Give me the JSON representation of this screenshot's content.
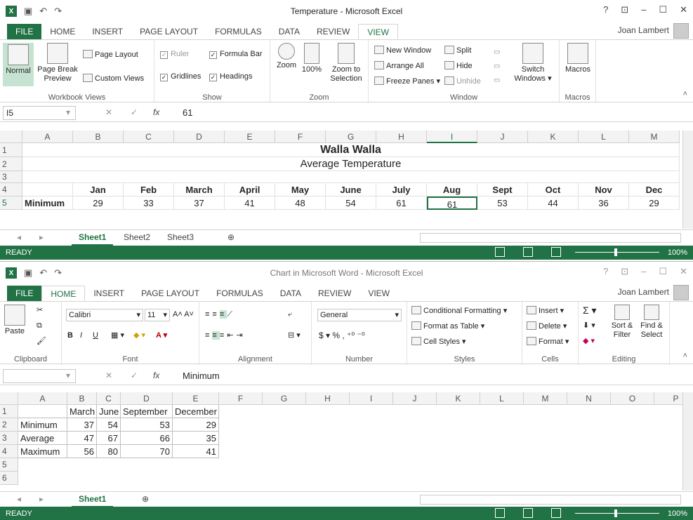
{
  "user": "Joan Lambert",
  "win1": {
    "title": "Temperature - Microsoft Excel",
    "tabs": [
      "FILE",
      "HOME",
      "INSERT",
      "PAGE LAYOUT",
      "FORMULAS",
      "DATA",
      "REVIEW",
      "VIEW"
    ],
    "active_tab": "VIEW",
    "groups": {
      "workbook": {
        "label": "Workbook Views",
        "normal": "Normal",
        "page_break": "Page Break Preview",
        "page_layout": "Page Layout",
        "custom_views": "Custom Views"
      },
      "show": {
        "label": "Show",
        "ruler": "Ruler",
        "formula_bar": "Formula Bar",
        "gridlines": "Gridlines",
        "headings": "Headings"
      },
      "zoom": {
        "label": "Zoom",
        "zoom": "Zoom",
        "z100": "100%",
        "zoom_sel": "Zoom to Selection"
      },
      "window": {
        "label": "Window",
        "new_window": "New Window",
        "arrange_all": "Arrange All",
        "freeze": "Freeze Panes",
        "split": "Split",
        "hide": "Hide",
        "unhide": "Unhide",
        "switch": "Switch Windows"
      },
      "macros": {
        "label": "Macros",
        "macros": "Macros"
      }
    },
    "namebox": "I5",
    "formula": "61",
    "col_headers": [
      "A",
      "B",
      "C",
      "D",
      "E",
      "F",
      "G",
      "H",
      "I",
      "J",
      "K",
      "L",
      "M"
    ],
    "row_headers": [
      "1",
      "2",
      "3",
      "4",
      "5"
    ],
    "sheet_title": "Walla Walla",
    "sheet_subtitle": "Average Temperature",
    "months": [
      "Jan",
      "Feb",
      "March",
      "April",
      "May",
      "June",
      "July",
      "Aug",
      "Sept",
      "Oct",
      "Nov",
      "Dec"
    ],
    "row5_label": "Minimum",
    "row5_values": [
      "29",
      "33",
      "37",
      "41",
      "48",
      "54",
      "61",
      "61",
      "53",
      "44",
      "36",
      "29"
    ],
    "sheets": [
      "Sheet1",
      "Sheet2",
      "Sheet3"
    ],
    "status": "READY",
    "zoom": "100%"
  },
  "win2": {
    "title": "Chart in Microsoft Word - Microsoft Excel",
    "tabs": [
      "FILE",
      "HOME",
      "INSERT",
      "PAGE LAYOUT",
      "FORMULAS",
      "DATA",
      "REVIEW",
      "VIEW"
    ],
    "active_tab": "HOME",
    "groups": {
      "clipboard": {
        "label": "Clipboard",
        "paste": "Paste"
      },
      "font": {
        "label": "Font",
        "name": "Calibri",
        "size": "11",
        "bold": "B",
        "italic": "I",
        "underline": "U"
      },
      "alignment": {
        "label": "Alignment"
      },
      "number": {
        "label": "Number",
        "format": "General"
      },
      "styles": {
        "label": "Styles",
        "cond": "Conditional Formatting",
        "table": "Format as Table",
        "cell": "Cell Styles"
      },
      "cells": {
        "label": "Cells",
        "insert": "Insert",
        "delete": "Delete",
        "format": "Format"
      },
      "editing": {
        "label": "Editing",
        "sort": "Sort & Filter",
        "find": "Find & Select"
      }
    },
    "namebox": "",
    "formula": "Minimum",
    "col_headers": [
      "A",
      "B",
      "C",
      "D",
      "E",
      "F",
      "G",
      "H",
      "I",
      "J",
      "K",
      "L",
      "M",
      "N",
      "O",
      "P"
    ],
    "row_headers": [
      "1",
      "2",
      "3",
      "4",
      "5",
      "6"
    ],
    "header_row": [
      "",
      "March",
      "June",
      "September",
      "December"
    ],
    "rows": [
      [
        "Minimum",
        "37",
        "54",
        "53",
        "29"
      ],
      [
        "Average",
        "47",
        "67",
        "66",
        "35"
      ],
      [
        "Maximum",
        "56",
        "80",
        "70",
        "41"
      ]
    ],
    "sheets": [
      "Sheet1"
    ],
    "status": "READY",
    "zoom": "100%"
  }
}
